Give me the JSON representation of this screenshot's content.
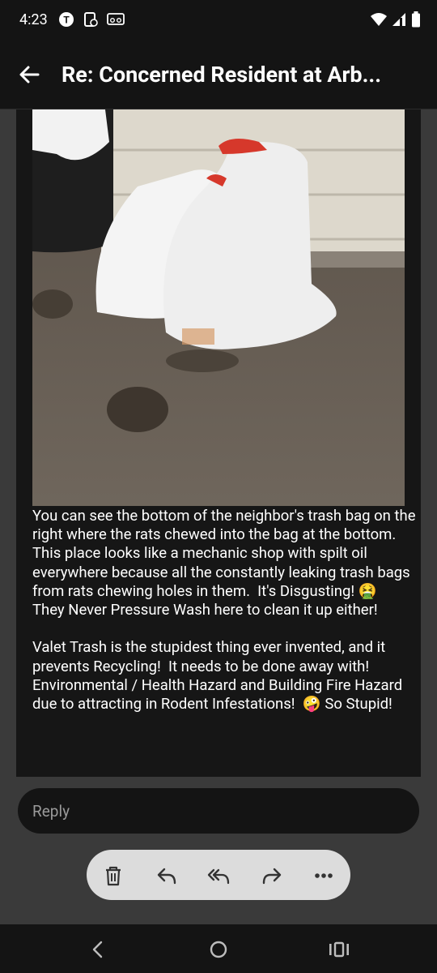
{
  "status_bar": {
    "time": "4:23",
    "left_icons": [
      "t-mobile-icon",
      "phone-sync-icon",
      "voicemail-icon"
    ],
    "right_icons": [
      "wifi-icon",
      "cell-signal-icon",
      "battery-icon"
    ]
  },
  "app_bar": {
    "back_icon": "arrow-left-icon",
    "title": "Re: Concerned Resident at Arb..."
  },
  "email": {
    "image_description_icon": "photo-of-trash-bags",
    "body": "You can see the bottom of the neighbor's trash bag on the right where the rats chewed into the bag at the bottom.  This place looks like a mechanic shop with spilt oil everywhere because all the constantly leaking trash bags from rats chewing holes in them.  It's Disgusting! 🤮\nThey Never Pressure Wash here to clean it up either!\n\nValet Trash is the stupidest thing ever invented, and it prevents Recycling!  It needs to be done away with!  Environmental / Health Hazard and Building Fire Hazard due to attracting in Rodent Infestations!  🤪 So Stupid!"
  },
  "reply": {
    "placeholder": "Reply"
  },
  "actions": [
    "trash-icon",
    "reply-icon",
    "reply-all-icon",
    "forward-icon",
    "more-icon"
  ],
  "nav": [
    "back-chevron-icon",
    "home-circle-icon",
    "recents-icon"
  ],
  "colors": {
    "bar": "#141414",
    "content": "#161616",
    "pill": "#dcdcdc",
    "background": "#3a3a3a"
  }
}
